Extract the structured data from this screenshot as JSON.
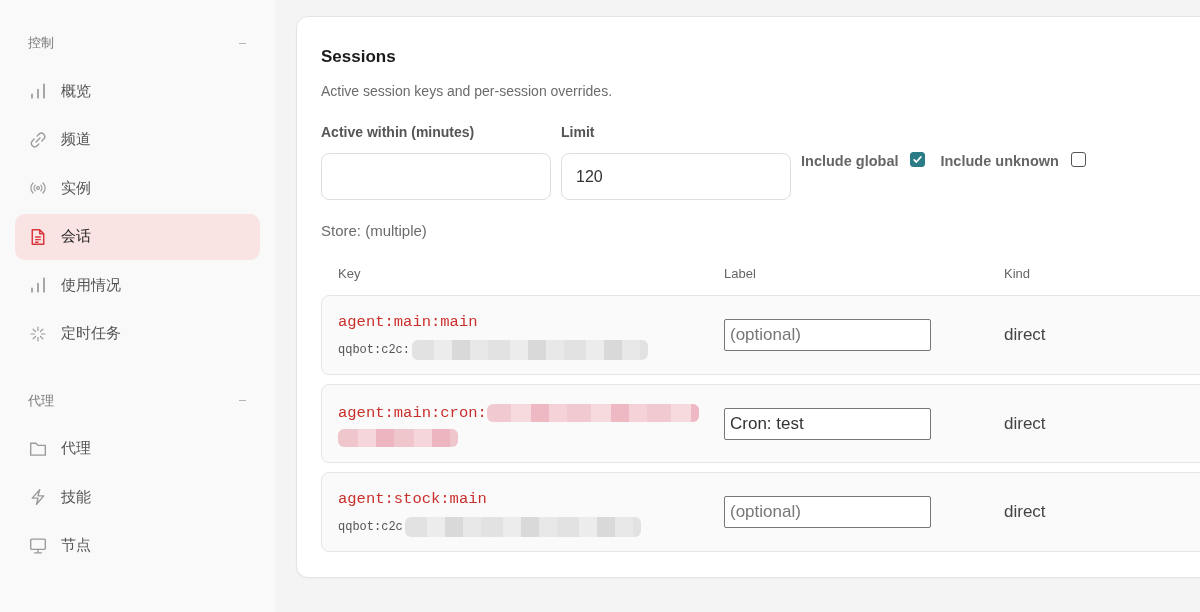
{
  "sidebar": {
    "sections": [
      {
        "title": "控制",
        "expanded": true,
        "items": [
          {
            "label": "概览",
            "selected": false
          },
          {
            "label": "频道",
            "selected": false
          },
          {
            "label": "实例",
            "selected": false
          },
          {
            "label": "会话",
            "selected": true
          },
          {
            "label": "使用情况",
            "selected": false
          },
          {
            "label": "定时任务",
            "selected": false
          }
        ]
      },
      {
        "title": "代理",
        "expanded": true,
        "items": [
          {
            "label": "代理",
            "selected": false
          },
          {
            "label": "技能",
            "selected": false
          },
          {
            "label": "节点",
            "selected": false
          }
        ]
      }
    ]
  },
  "sessions": {
    "title": "Sessions",
    "subtitle": "Active session keys and per-session overrides.",
    "fields": [
      {
        "label": "Active within (minutes)"
      },
      {
        "label": "Limit",
        "value": "120"
      }
    ],
    "checkboxes": [
      {
        "label": "Include global",
        "checked": true
      },
      {
        "label": "Include unknown",
        "checked": false
      }
    ],
    "store": "Store: (multiple)",
    "table": {
      "columns": [
        "Key",
        "Label",
        "Kind"
      ],
      "rows": [
        {
          "key": "agent:main:main",
          "key_redacted": false,
          "sub": "qqbot:c2c:",
          "sub_redacted": true,
          "label": {
            "placeholder": "(optional)"
          },
          "session_kind": "direct"
        },
        {
          "key": "agent:main:cron:",
          "key_redacted": true,
          "label": {
            "value": "Cron: test"
          },
          "session_kind": "direct"
        },
        {
          "key": "agent:stock:main",
          "key_redacted": false,
          "sub": "qqbot:c2c",
          "sub_redacted": true,
          "label": {
            "placeholder": "(optional)"
          },
          "session_kind": "direct"
        }
      ]
    }
  }
}
